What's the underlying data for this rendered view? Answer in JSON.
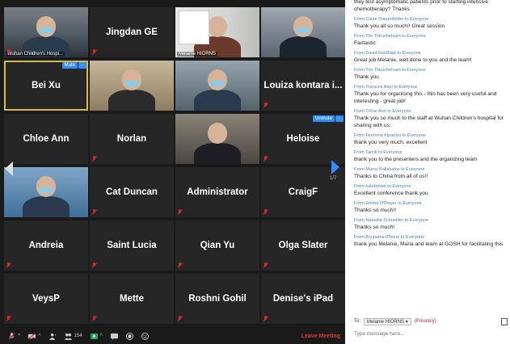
{
  "grid": {
    "tiles": [
      {
        "name": "",
        "caption": "Wuhan Children's Hospi...",
        "kind": "video-office",
        "muted": true
      },
      {
        "name": "Jingdan GE",
        "muted": true
      },
      {
        "name": "",
        "caption": "Melanie HIORNS",
        "kind": "video-melanie",
        "muted": false
      },
      {
        "name": "",
        "kind": "video-masked-woman",
        "muted": false
      },
      {
        "name": "Bei Xu",
        "muted": false,
        "active": true,
        "badge": "Mute"
      },
      {
        "name": "",
        "kind": "video-mask-glasses",
        "muted": false
      },
      {
        "name": "",
        "kind": "video-classroom",
        "muted": false
      },
      {
        "name": "Louiza kontara i...",
        "muted": true
      },
      {
        "name": "Chloe Ann",
        "muted": false
      },
      {
        "name": "Norlan",
        "muted": true
      },
      {
        "name": "",
        "kind": "video-man-suit",
        "muted": false
      },
      {
        "name": "Heloise",
        "muted": true,
        "badge": "Unmute"
      },
      {
        "name": "",
        "kind": "video-mask-man",
        "muted": false
      },
      {
        "name": "Cat Duncan",
        "muted": true
      },
      {
        "name": "Administrator",
        "muted": true
      },
      {
        "name": "CraigF",
        "muted": true
      },
      {
        "name": "Andreia",
        "muted": true
      },
      {
        "name": "Saint Lucia",
        "muted": true
      },
      {
        "name": "Qian Yu",
        "muted": true
      },
      {
        "name": "Olga Slater",
        "muted": true
      },
      {
        "name": "VeysP",
        "muted": true
      },
      {
        "name": "Mette",
        "muted": true
      },
      {
        "name": "Roshni Gohil",
        "muted": true
      },
      {
        "name": "Denise's iPad",
        "muted": true
      }
    ],
    "page_indicator": "1/7"
  },
  "toolbar": {
    "participants_count": "154",
    "leave_label": "Leave Meeting"
  },
  "chat": {
    "messages": [
      {
        "from": "",
        "text": "they test asymptomatic patients prior to starting intensive chemotherapy? Thanks"
      },
      {
        "from": "From Claire Frauenfelder to Everyone",
        "text": "Thank you all so much!! Great session"
      },
      {
        "from": "From Tim Thiruchelvam to Everyone",
        "text": "Fantastic"
      },
      {
        "from": "From David Goldblatt to Everyone",
        "text": "Great job Melanie, well done to you and the team!"
      },
      {
        "from": "From Tim Thiruchelvam to Everyone",
        "text": "Thank you"
      },
      {
        "from": "From Francois Abel to Everyone",
        "text": "Thank you for organising this - this has been very useful and interesting - great job!"
      },
      {
        "from": "From Chloe Ann to Everyone",
        "text": "Thank you so much to the staff at Wuhan Children's hospital for sharing with us."
      },
      {
        "from": "From Fevronia Kiparissi to Everyone",
        "text": "thank you very much, excellent"
      },
      {
        "from": "From Tarcik to Everyone",
        "text": "thank you to the presenters and the organizing team"
      },
      {
        "from": "From Maros Kallakatos to Everyone",
        "text": "Thanks to China from all of us!!"
      },
      {
        "from": "From katebrown to Everyone",
        "text": "Excellent conference thank you"
      },
      {
        "from": "From Emma O'Dwyer to Everyone",
        "text": "Thanks so much!!"
      },
      {
        "from": "From Natasha Schneider to Everyone",
        "text": "Thanks so much!"
      },
      {
        "from": "From Anupama iPhone to Everyone",
        "text": "thank you Melanie, Maria and team at GOSH for facilitating this"
      }
    ],
    "to_label": "To:",
    "to_value": "Melanie HIORNS",
    "privately": "(Privately)",
    "input_placeholder": "Type message here..."
  }
}
